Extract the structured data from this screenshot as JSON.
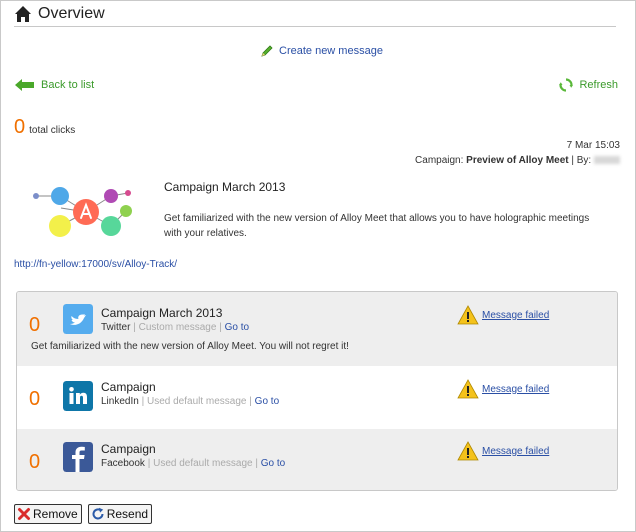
{
  "header": {
    "title": "Overview",
    "icon": "home-icon"
  },
  "actions": {
    "create_label": "Create new message",
    "back_label": "Back to list",
    "refresh_label": "Refresh"
  },
  "summary": {
    "total_clicks": "0",
    "total_clicks_label": "total clicks",
    "date": "7 Mar 15:03",
    "campaign_prefix": "Campaign:",
    "campaign_name": "Preview of Alloy Meet",
    "by_label": "| By:"
  },
  "campaign": {
    "title": "Campaign March 2013",
    "description": "Get familiarized with the new version of Alloy Meet that allows you to have holographic meetings with your relatives.",
    "link": "http://fn-yellow:17000/sv/Alloy-Track/"
  },
  "messages": [
    {
      "count": "0",
      "network_icon": "twitter-icon",
      "title": "Campaign March 2013",
      "network": "Twitter",
      "message_type": "Custom message",
      "goto_label": "Go to",
      "status": "Message failed",
      "body": "Get familiarized with the new version of Alloy Meet. You will not regret it!"
    },
    {
      "count": "0",
      "network_icon": "linkedin-icon",
      "title": "Campaign",
      "network": "LinkedIn",
      "message_type": "Used default message",
      "goto_label": "Go to",
      "status": "Message failed"
    },
    {
      "count": "0",
      "network_icon": "facebook-icon",
      "title": "Campaign",
      "network": "Facebook",
      "message_type": "Used default message",
      "goto_label": "Go to",
      "status": "Message failed"
    }
  ],
  "buttons": {
    "remove_label": "Remove",
    "resend_label": "Resend"
  },
  "colors": {
    "accent_orange": "#f07000",
    "link_blue": "#2a4fa5",
    "green": "#3a9a2a",
    "twitter": "#55acee",
    "linkedin": "#0e76a8",
    "facebook": "#3b5998"
  }
}
